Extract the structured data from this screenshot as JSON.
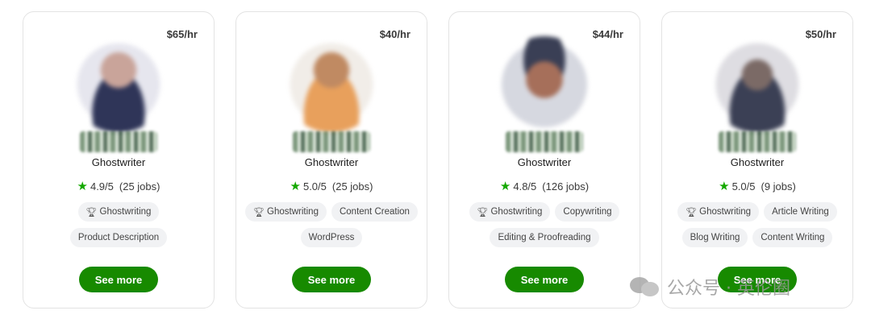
{
  "freelancers": [
    {
      "rate": "$65/hr",
      "title": "Ghostwriter",
      "rating": "4.9/5",
      "jobs": "(25 jobs)",
      "tags": [
        {
          "label": "Ghostwriting",
          "icon": "trophy-icon"
        },
        {
          "label": "Product Description"
        }
      ],
      "button": "See more"
    },
    {
      "rate": "$40/hr",
      "title": "Ghostwriter",
      "rating": "5.0/5",
      "jobs": "(25 jobs)",
      "tags": [
        {
          "label": "Ghostwriting",
          "icon": "trophy-icon"
        },
        {
          "label": "Content Creation"
        },
        {
          "label": "WordPress"
        }
      ],
      "button": "See more"
    },
    {
      "rate": "$44/hr",
      "title": "Ghostwriter",
      "rating": "4.8/5",
      "jobs": "(126 jobs)",
      "tags": [
        {
          "label": "Ghostwriting",
          "icon": "trophy-icon"
        },
        {
          "label": "Copywriting"
        },
        {
          "label": "Editing & Proofreading"
        }
      ],
      "button": "See more"
    },
    {
      "rate": "$50/hr",
      "title": "Ghostwriter",
      "rating": "5.0/5",
      "jobs": "(9 jobs)",
      "tags": [
        {
          "label": "Ghostwriting",
          "icon": "trophy-icon"
        },
        {
          "label": "Article Writing"
        },
        {
          "label": "Blog Writing"
        },
        {
          "label": "Content Writing"
        }
      ],
      "button": "See more"
    }
  ],
  "watermark": "公众号 · 英伦圈",
  "colors": {
    "accent": "#178a00",
    "star": "#14a800",
    "tag_bg": "#f1f2f4"
  }
}
